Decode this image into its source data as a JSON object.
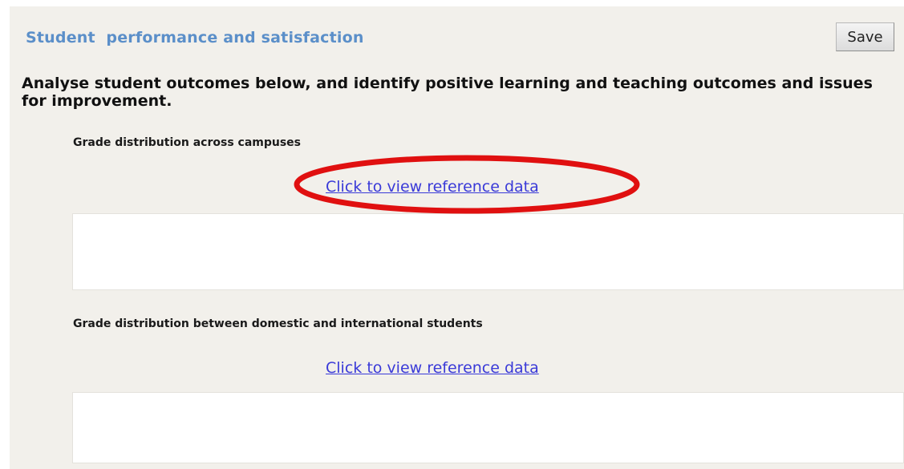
{
  "section": {
    "title": "Student  performance and satisfaction",
    "save_label": "Save",
    "instructions": "Analyse student outcomes below, and identify positive learning and teaching outcomes and issues for improvement."
  },
  "subsections": [
    {
      "heading": "Grade distribution across campuses",
      "link_label": "Click to view reference data",
      "answer_value": ""
    },
    {
      "heading": "Grade distribution between domestic and international students",
      "link_label": "Click to view reference data",
      "answer_value": ""
    }
  ],
  "annotation": {
    "highlight_color": "#e01010"
  }
}
